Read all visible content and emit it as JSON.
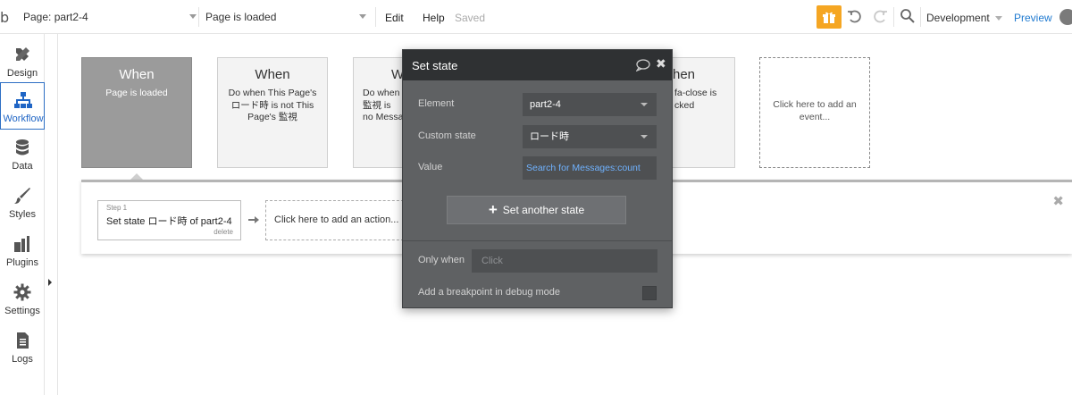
{
  "topbar": {
    "logo": "b",
    "page_select": "Page: part2-4",
    "event_select": "Page is loaded",
    "menu_edit": "Edit",
    "menu_help": "Help",
    "saved_status": "Saved",
    "environment": "Development",
    "preview": "Preview",
    "accent_color": "#f5a623"
  },
  "sidebar": {
    "items": [
      {
        "label": "Design",
        "icon": "design-icon"
      },
      {
        "label": "Workflow",
        "icon": "workflow-icon"
      },
      {
        "label": "Data",
        "icon": "database-icon"
      },
      {
        "label": "Styles",
        "icon": "brush-icon"
      },
      {
        "label": "Plugins",
        "icon": "plugin-icon"
      },
      {
        "label": "Settings",
        "icon": "gear-icon"
      },
      {
        "label": "Logs",
        "icon": "document-icon"
      }
    ],
    "active_index": 1
  },
  "events": [
    {
      "title": "When",
      "desc": "Page is loaded"
    },
    {
      "title": "When",
      "desc": "Do when This Page's ロード時 is not This Page's 監視"
    },
    {
      "title": "W",
      "desc": "Do when 監視 is no Messa"
    },
    {
      "title": "hen",
      "desc": "fa-close is cked"
    },
    {
      "title": "",
      "desc": "Click here to add an event..."
    }
  ],
  "actions": {
    "step_number": "Step 1",
    "step_label": "Set state ロード時 of part2-4",
    "delete": "delete",
    "add_action": "Click here to add an action..."
  },
  "panel": {
    "title": "Set state",
    "element_label": "Element",
    "element_value": "part2-4",
    "custom_state_label": "Custom state",
    "custom_state_value": "ロード時",
    "value_label": "Value",
    "value_value": "Search for Messages:count",
    "set_another": "Set another state",
    "only_when_label": "Only when",
    "only_when_placeholder": "Click",
    "breakpoint_label": "Add a breakpoint in debug mode",
    "link_color": "#6fb2ff"
  }
}
